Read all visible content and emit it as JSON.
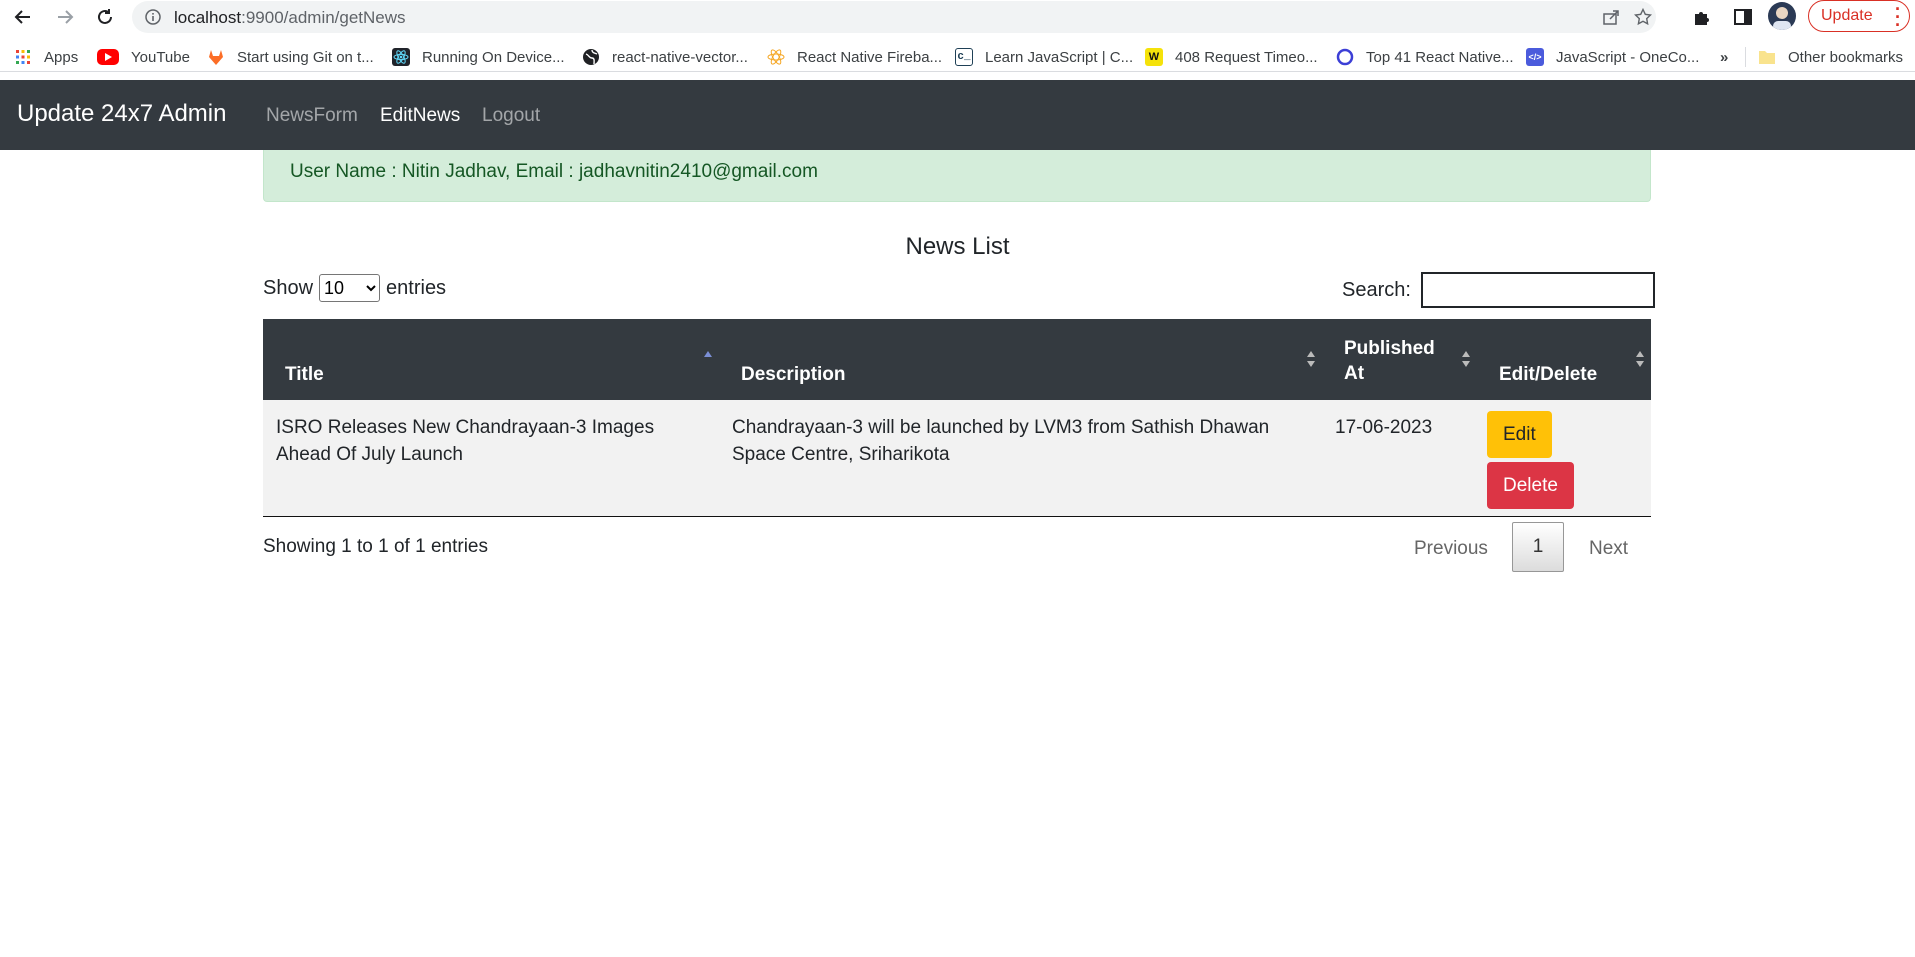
{
  "browser": {
    "url_host": "localhost",
    "url_rest": ":9900/admin/getNews",
    "update_label": "Update",
    "bookmarks": [
      {
        "label": "Apps",
        "icon": "apps-grid-icon"
      },
      {
        "label": "YouTube",
        "icon": "youtube-icon"
      },
      {
        "label": "Start using Git on t...",
        "icon": "gitlab-icon"
      },
      {
        "label": "Running On Device...",
        "icon": "react-icon"
      },
      {
        "label": "react-native-vector...",
        "icon": "globe-icon"
      },
      {
        "label": "React Native Fireba...",
        "icon": "react-firebase-icon"
      },
      {
        "label": "Learn JavaScript | C...",
        "icon": "codecademy-icon"
      },
      {
        "label": "408 Request Timeo...",
        "icon": "w-icon"
      },
      {
        "label": "Top 41 React Native...",
        "icon": "ring-icon"
      },
      {
        "label": "JavaScript - OneCo...",
        "icon": "code-icon"
      }
    ],
    "more_bookmarks": "»",
    "other_bookmarks": "Other bookmarks"
  },
  "navbar": {
    "brand": "Update 24x7 Admin",
    "links": [
      "NewsForm",
      "EditNews",
      "Logout"
    ],
    "active": "EditNews"
  },
  "alert": {
    "text": "User Name : Nitin Jadhav, Email : jadhavnitin2410@gmail.com"
  },
  "list": {
    "title": "News List",
    "show_label": "Show",
    "entries_label": "entries",
    "page_length": "10",
    "search_label": "Search:",
    "search_value": "",
    "columns": [
      "Title",
      "Description",
      "Published At",
      "Edit/Delete"
    ],
    "rows": [
      {
        "title": "ISRO Releases New Chandrayaan-3 Images Ahead Of July Launch",
        "description": "Chandrayaan-3 will be launched by LVM3 from Sathish Dhawan Space Centre, Sriharikota",
        "published_at": "17-06-2023",
        "edit_label": "Edit",
        "delete_label": "Delete"
      }
    ],
    "info": "Showing 1 to 1 of 1 entries",
    "pagination": {
      "previous": "Previous",
      "current": "1",
      "next": "Next"
    }
  },
  "colors": {
    "navbar": "#343a40",
    "alert_bg": "#d4edda",
    "alert_text": "#155724",
    "edit": "#ffc107",
    "delete": "#dc3545"
  }
}
